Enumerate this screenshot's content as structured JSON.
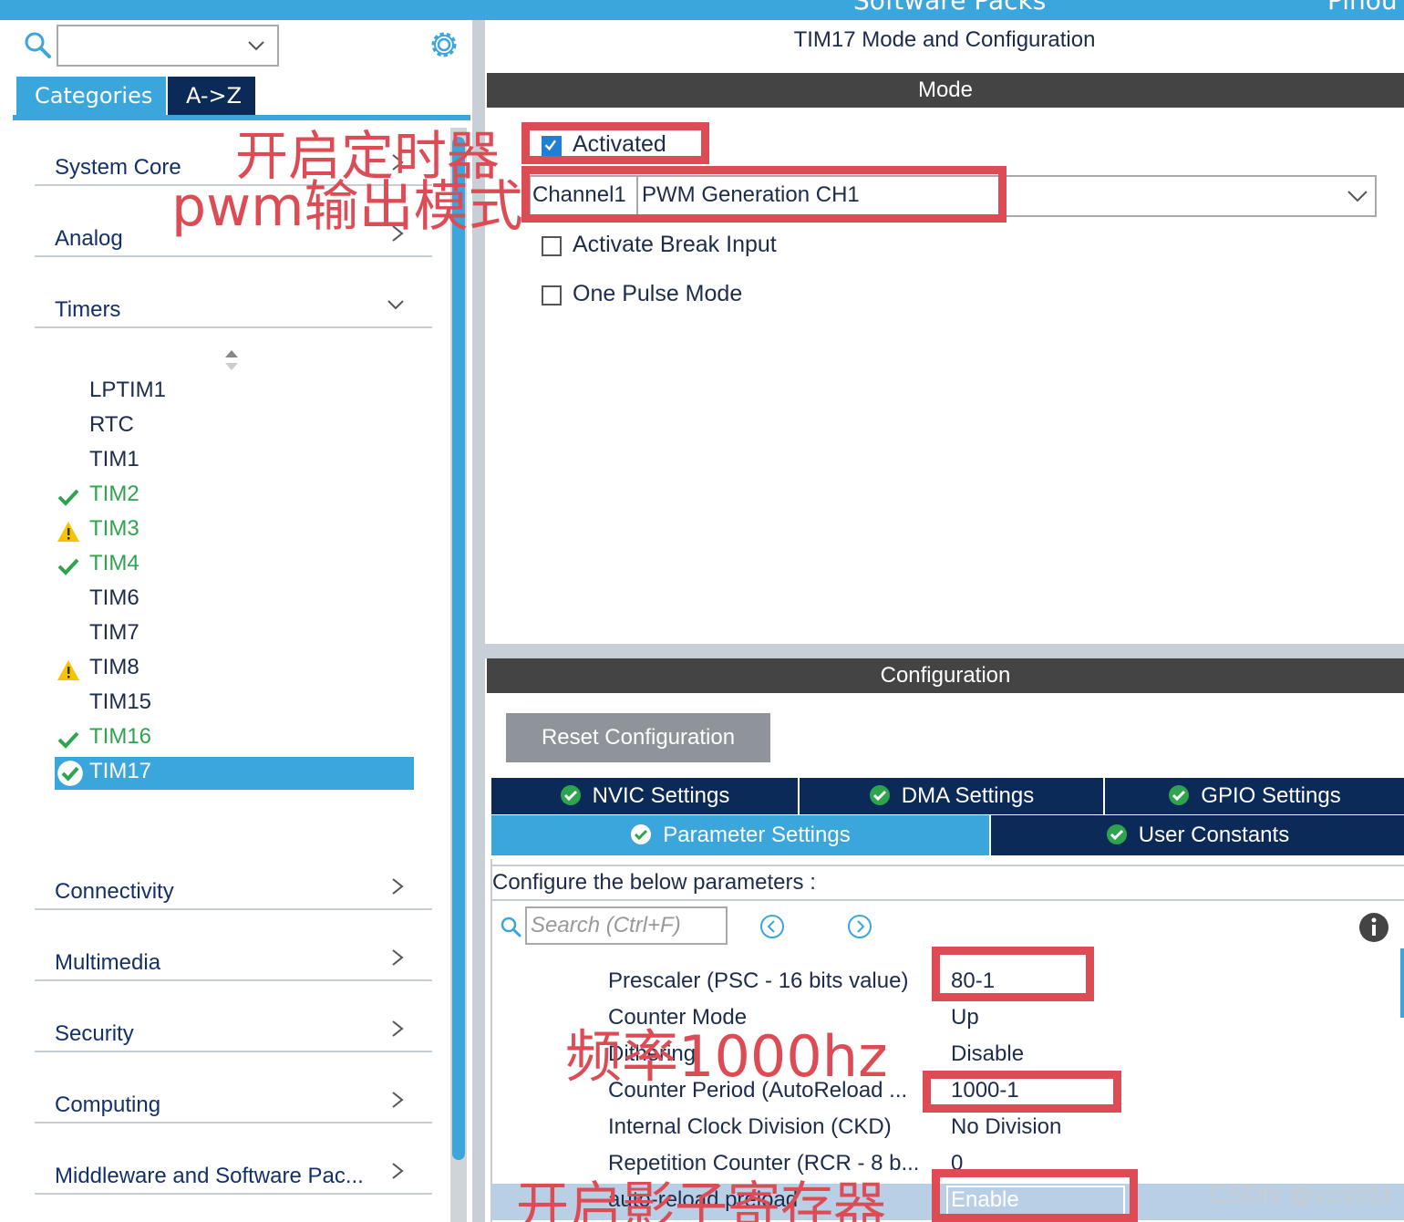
{
  "top_bar": {
    "left_text": "Software Packs",
    "right_text": "Pinou"
  },
  "left_panel": {
    "search_value": "",
    "tabs": {
      "categories": "Categories",
      "az": "A->Z"
    },
    "categories_top": [
      {
        "label": "System Core"
      },
      {
        "label": "Analog"
      },
      {
        "label": "Timers"
      }
    ],
    "timers": [
      {
        "name": "LPTIM1",
        "status": "none"
      },
      {
        "name": "RTC",
        "status": "none"
      },
      {
        "name": "TIM1",
        "status": "none"
      },
      {
        "name": "TIM2",
        "status": "ok"
      },
      {
        "name": "TIM3",
        "status": "warn"
      },
      {
        "name": "TIM4",
        "status": "ok"
      },
      {
        "name": "TIM6",
        "status": "none"
      },
      {
        "name": "TIM7",
        "status": "none"
      },
      {
        "name": "TIM8",
        "status": "warn"
      },
      {
        "name": "TIM15",
        "status": "none"
      },
      {
        "name": "TIM16",
        "status": "ok"
      },
      {
        "name": "TIM17",
        "status": "selected"
      }
    ],
    "categories_bottom": [
      {
        "label": "Connectivity"
      },
      {
        "label": "Multimedia"
      },
      {
        "label": "Security"
      },
      {
        "label": "Computing"
      },
      {
        "label": "Middleware and Software Pac..."
      }
    ]
  },
  "right_panel": {
    "title": "TIM17 Mode and Configuration",
    "mode_header": "Mode",
    "activated": {
      "label": "Activated",
      "checked": true
    },
    "channel": {
      "label": "Channel1",
      "value": "PWM Generation CH1"
    },
    "break_input": {
      "label": "Activate Break Input",
      "checked": false
    },
    "one_pulse": {
      "label": "One Pulse Mode",
      "checked": false
    },
    "config_header": "Configuration",
    "reset_button": "Reset Configuration",
    "tabs_row1": [
      "NVIC Settings",
      "DMA Settings",
      "GPIO Settings"
    ],
    "tabs_row2": [
      "Parameter Settings",
      "User Constants"
    ],
    "active_tab": "Parameter Settings",
    "configure_text": "Configure the below parameters :",
    "search_placeholder": "Search (Ctrl+F)",
    "params": [
      {
        "key": "Prescaler (PSC - 16 bits value)",
        "value": "80-1"
      },
      {
        "key": "Counter Mode",
        "value": "Up"
      },
      {
        "key": "Dithering",
        "value": "Disable"
      },
      {
        "key": "Counter Period (AutoReload ...",
        "value": "1000-1"
      },
      {
        "key": "Internal Clock Division (CKD)",
        "value": "No Division"
      },
      {
        "key": "Repetition Counter (RCR - 8 b...",
        "value": "0"
      },
      {
        "key": "auto-reload preload",
        "value": "Enable"
      }
    ]
  },
  "annotations": {
    "enable_timer": "开启定时器",
    "pwm_mode": "pwm输出模式",
    "freq": "频率1000hz",
    "shadow_reg": "开启影子寄存器"
  },
  "watermark": "CSDN @xc1011",
  "colors": {
    "accent": "#3aa6dc",
    "navy": "#0b2a57",
    "header_dark": "#444444",
    "ok_green": "#2ea44f",
    "warn_yellow": "#f5c400",
    "annotation_red": "#dd4b55"
  }
}
